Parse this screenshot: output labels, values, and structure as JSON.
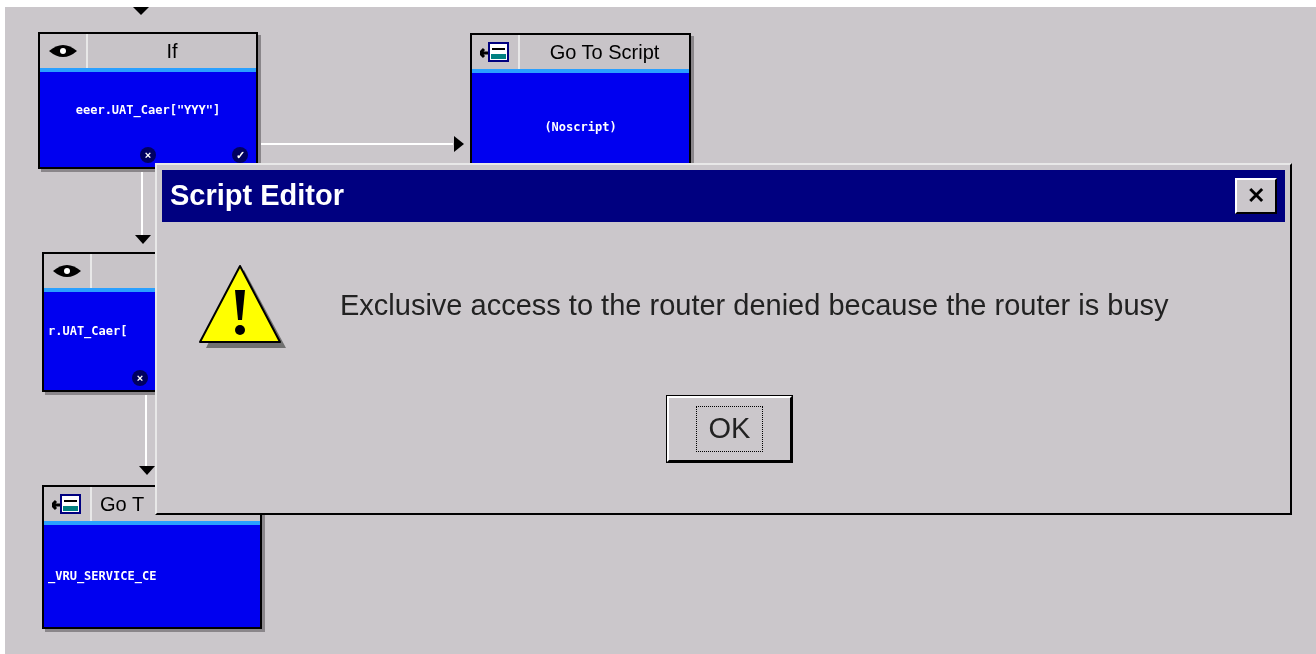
{
  "canvas": {
    "nodes": [
      {
        "kind": "if",
        "title": "If",
        "body": "eeer.UAT_Caer[\"YYY\"]",
        "ports": [
          "×",
          "✓"
        ]
      },
      {
        "kind": "goto",
        "title": "Go To Script",
        "body": "(Noscript)"
      },
      {
        "kind": "if",
        "body": "r.UAT_Caer[",
        "ports": [
          "×"
        ]
      },
      {
        "kind": "goto",
        "title": "Go T",
        "body": "_VRU_SERVICE_CE"
      }
    ]
  },
  "dialog": {
    "title": "Script Editor",
    "close": "✕",
    "kind": "warning",
    "message": "Exclusive access to the router denied because the router is busy",
    "buttons": [
      "OK"
    ]
  }
}
